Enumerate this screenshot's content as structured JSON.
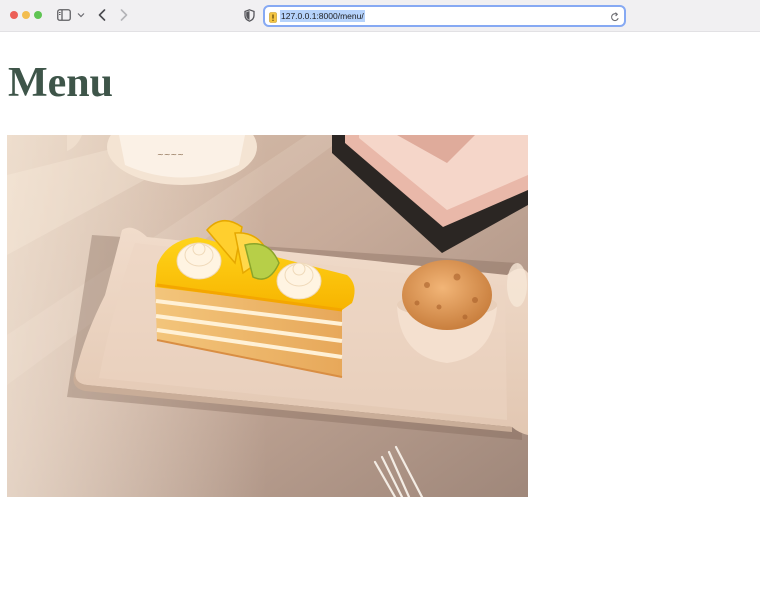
{
  "browser": {
    "url": "127.0.0.1:8000/menu/"
  },
  "page": {
    "title": "Menu",
    "hero_image": {
      "subject": "lemon-layer-cake-with-ice-cream"
    }
  },
  "icons": {
    "sidebar": "sidebar-icon",
    "back": "chevron-left-icon",
    "forward": "chevron-right-icon",
    "privacy": "shield-icon",
    "reload": "reload-icon"
  },
  "colors": {
    "title": "#3e5549",
    "url_highlight": "#b5d2fb",
    "url_focus_ring": "#86a9f3"
  }
}
